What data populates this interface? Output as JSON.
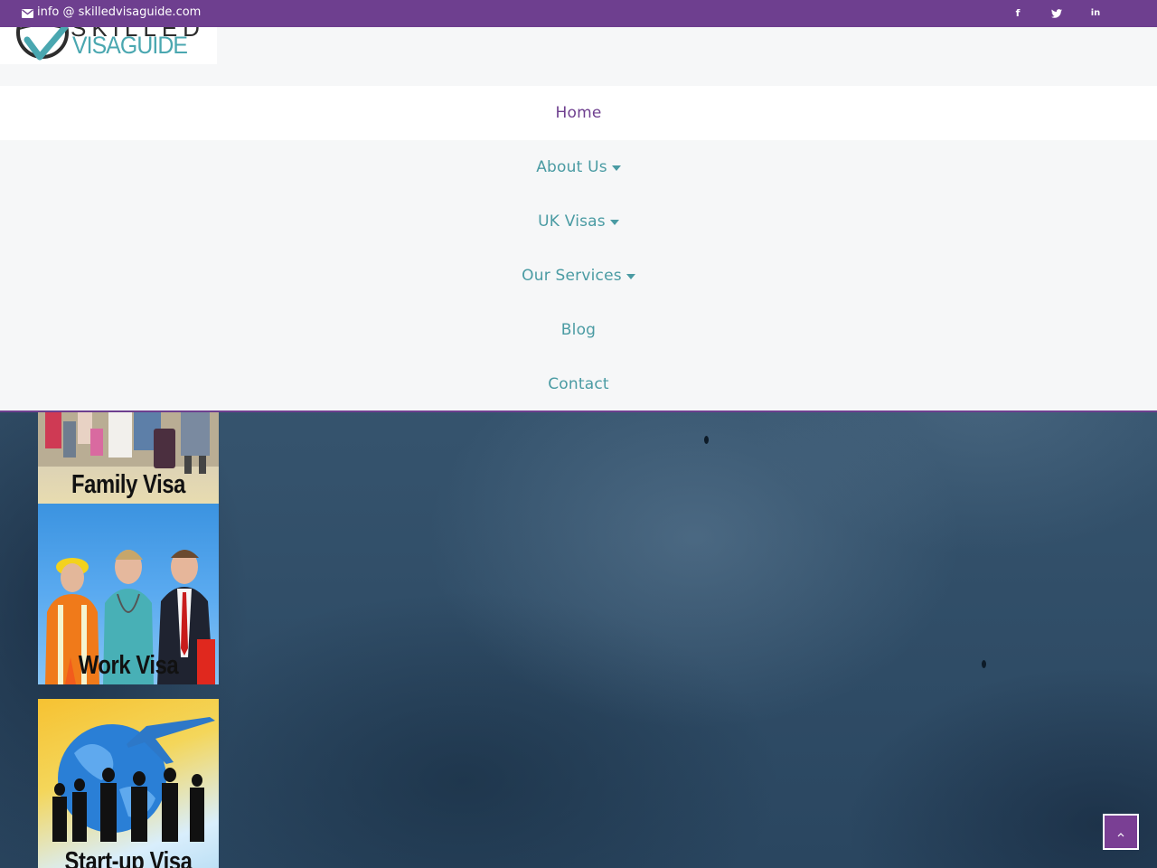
{
  "topbar": {
    "email": "info @ skilledvisaguide.com",
    "email_icon": "envelope-icon",
    "social": [
      {
        "name": "facebook-icon",
        "glyph": "f"
      },
      {
        "name": "twitter-icon",
        "glyph": "t"
      },
      {
        "name": "linkedin-icon",
        "glyph": "in"
      }
    ]
  },
  "logo": {
    "top_text": "SKILLED",
    "bottom_text": "VISAGUIDE"
  },
  "nav": {
    "items": [
      {
        "label": "Home"
      },
      {
        "label": "About Us"
      },
      {
        "label": "UK Visas"
      },
      {
        "label": "Our Services"
      },
      {
        "label": "Blog"
      },
      {
        "label": "Contact"
      }
    ]
  },
  "cards": [
    {
      "label": "Family Visa"
    },
    {
      "label": "Work Visa"
    },
    {
      "label": "Start-up Visa"
    }
  ],
  "back_to_top": {
    "icon": "chevron-up-icon",
    "glyph": "^"
  },
  "colors": {
    "purple": "#6e3f8f",
    "teal": "#4a9ba3",
    "nav_bg": "#f6f7f8"
  }
}
